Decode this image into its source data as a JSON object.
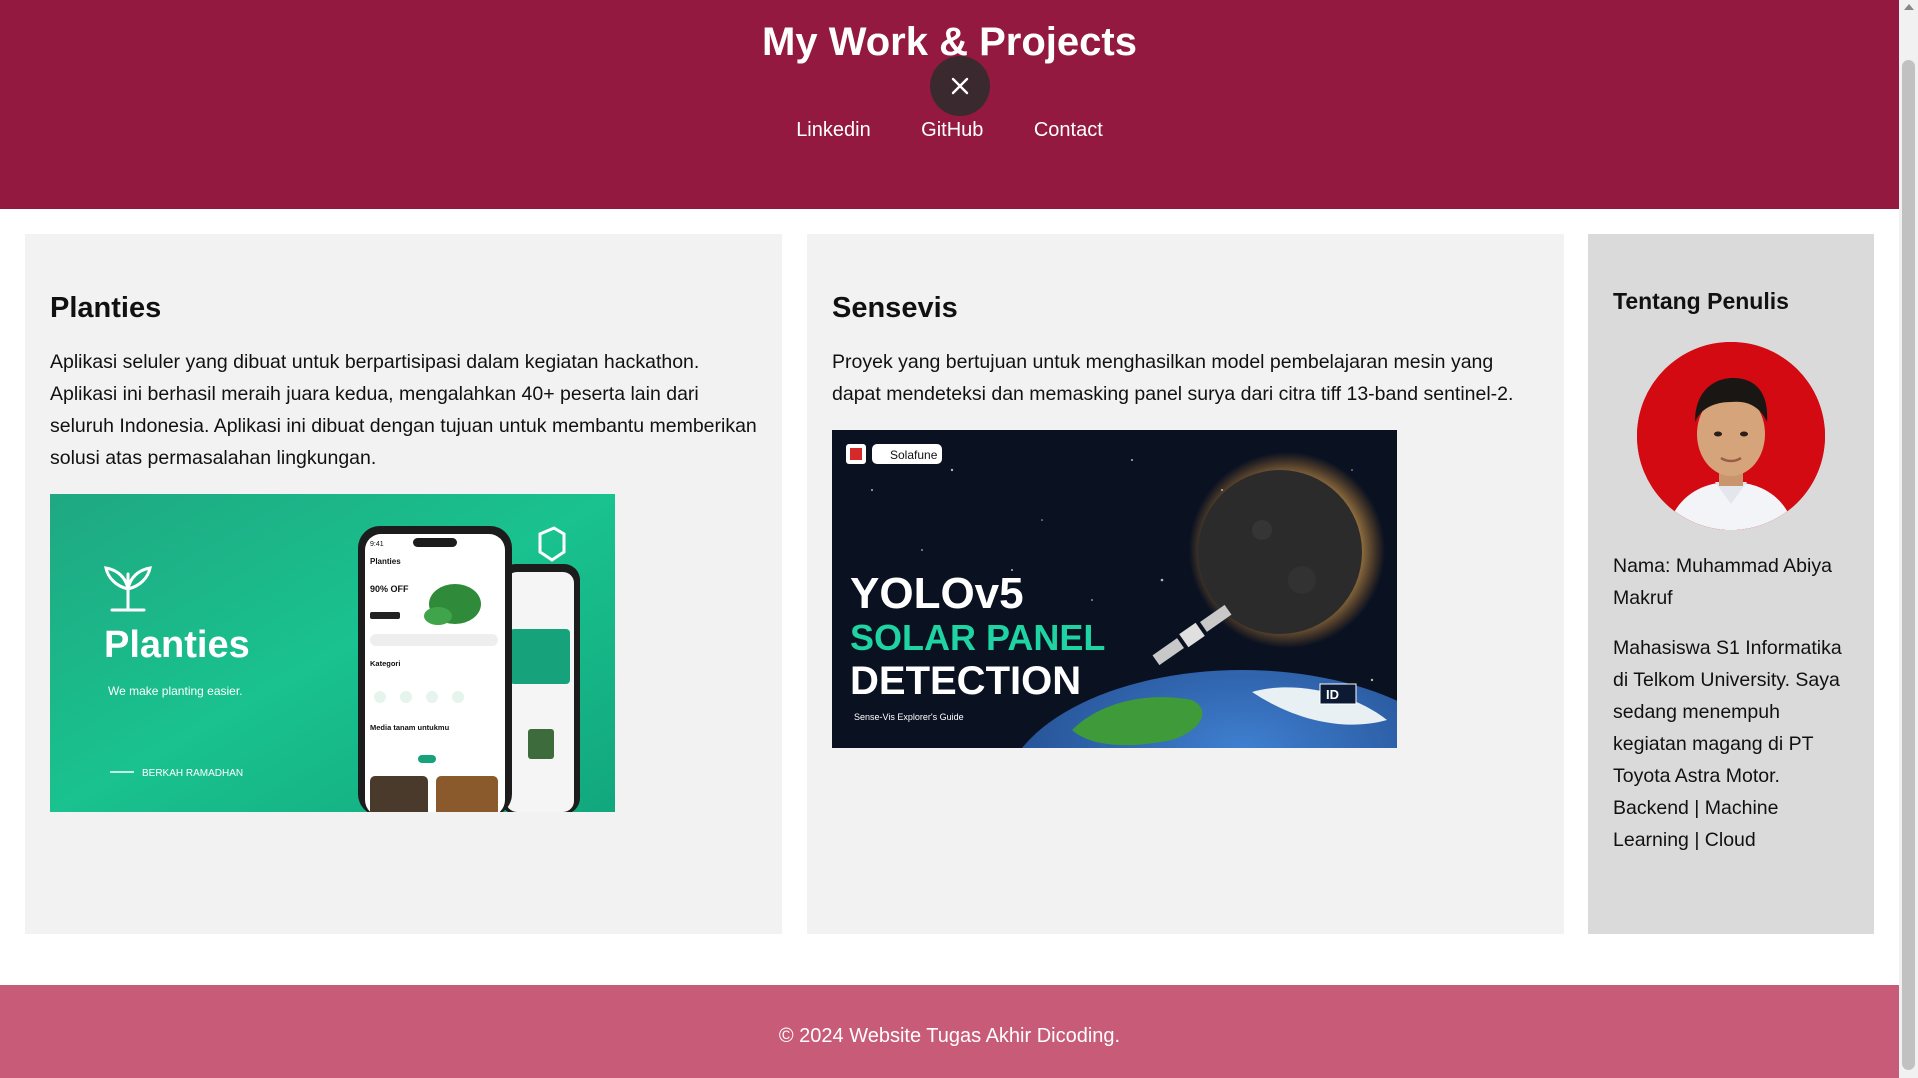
{
  "header": {
    "title": "My Work & Projects",
    "nav": [
      "Linkedin",
      "GitHub",
      "Contact"
    ],
    "color": "#931940"
  },
  "projects": [
    {
      "title": "Planties",
      "description": "Aplikasi seluler yang dibuat untuk berpartisipasi dalam kegiatan hackathon. Aplikasi ini berhasil meraih juara kedua, mengalahkan 40+ peserta lain dari seluruh Indonesia. Aplikasi ini dibuat dengan tujuan untuk membantu memberikan solusi atas permasalahan lingkungan.",
      "image": {
        "app_name": "Planties",
        "tagline": "We make planting easier.",
        "footer_text": "BERKAH RAMADHAN",
        "phone_title": "Planties",
        "promo": "90% OFF",
        "category": "Kategori",
        "section": "Media tanam untukmu",
        "time": "9:41"
      }
    },
    {
      "title": "Sensevis",
      "description": "Proyek yang bertujuan untuk menghasilkan model pembelajaran mesin yang dapat mendeteksi dan memasking panel surya dari citra tiff 13-band sentinel-2.",
      "image": {
        "logo": "Solafune",
        "line1": "YOLOv5",
        "line2": "SOLAR PANEL",
        "line3": "DETECTION",
        "subtitle": "Sense-Vis Explorer's Guide",
        "badge": "ID"
      }
    }
  ],
  "sidebar": {
    "title": "Tentang Penulis",
    "name": "Nama: Muhammad Abiya Makruf",
    "bio": "Mahasiswa S1 Informatika di Telkom University. Saya sedang menempuh kegiatan magang di PT Toyota Astra Motor.",
    "skills": "Backend | Machine Learning | Cloud"
  },
  "footer": {
    "text": "© 2024 Website Tugas Akhir Dicoding.",
    "color": "#c85b78"
  }
}
